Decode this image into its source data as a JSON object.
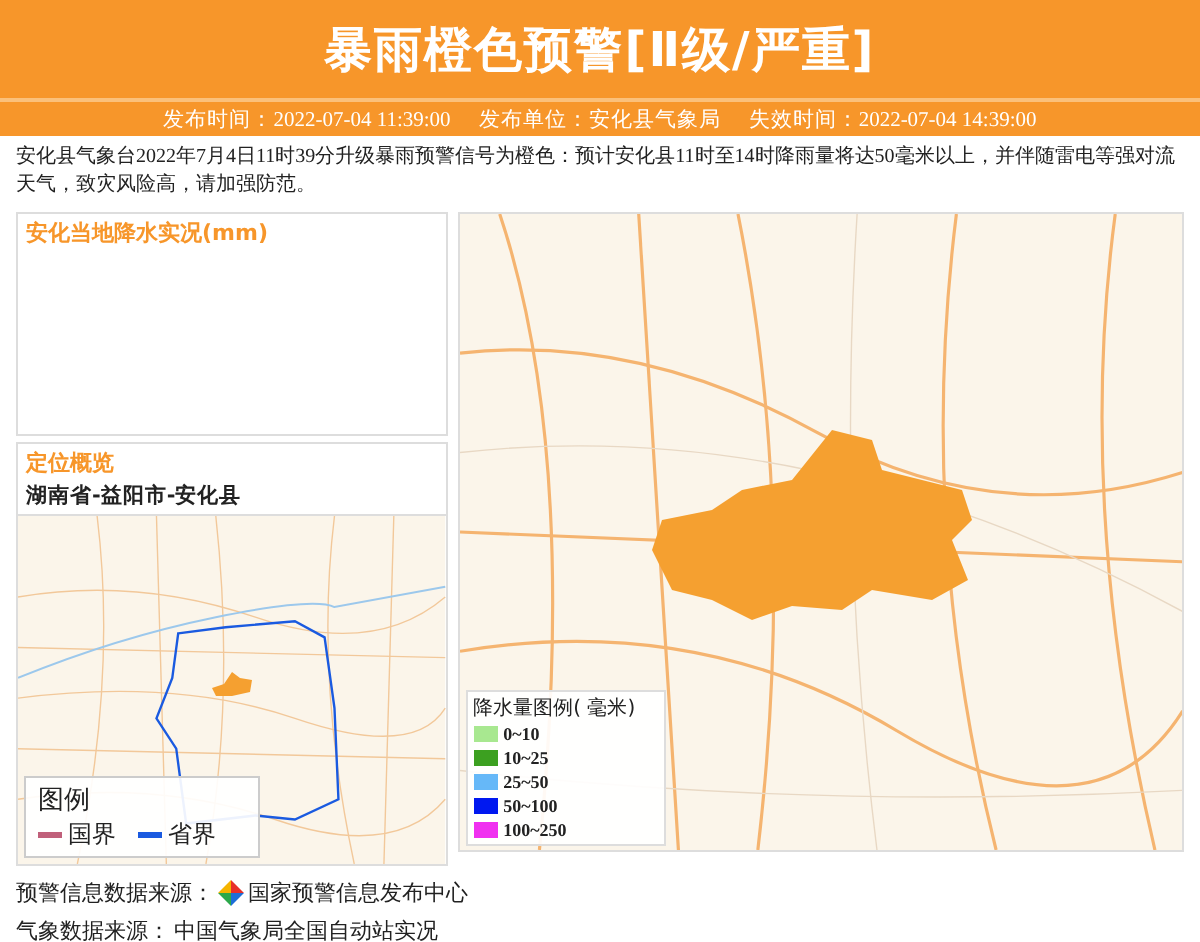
{
  "header": {
    "title": "暴雨橙色预警[Ⅱ级/严重]"
  },
  "info_bar": [
    {
      "label": "发布时间：",
      "value": "2022-07-04 11:39:00"
    },
    {
      "label": "发布单位：",
      "value": "安化县气象局"
    },
    {
      "label": "失效时间：",
      "value": "2022-07-04 14:39:00"
    }
  ],
  "description": "安化县气象台2022年7月4日11时39分升级暴雨预警信号为橙色：预计安化县11时至14时降雨量将达50毫米以上，并伴随雷电等强对流天气，致灾风险高，请加强防范。",
  "rainfall_panel": {
    "title": "安化当地降水实况(mm)"
  },
  "location_panel": {
    "title": "定位概览",
    "path": "湖南省-益阳市-安化县",
    "legend": {
      "title": "图例",
      "items": [
        {
          "label": "国界",
          "color": "#c0607a"
        },
        {
          "label": "省界",
          "color": "#1a5ae0"
        }
      ]
    }
  },
  "rain_legend": {
    "title": "降水量图例( 毫米)",
    "items": [
      {
        "label": "0~10",
        "color": "#a8e890"
      },
      {
        "label": "10~25",
        "color": "#3ca020"
      },
      {
        "label": "25~50",
        "color": "#66b8f8"
      },
      {
        "label": "50~100",
        "color": "#0018f0"
      },
      {
        "label": "100~250",
        "color": "#f030f0"
      }
    ]
  },
  "footer": [
    {
      "label": "预警信息数据来源：",
      "source": "国家预警信息发布中心",
      "kind": "logo"
    },
    {
      "label": "气象数据来源：",
      "source": "中国气象局全国自动站实况",
      "kind": "text"
    }
  ]
}
